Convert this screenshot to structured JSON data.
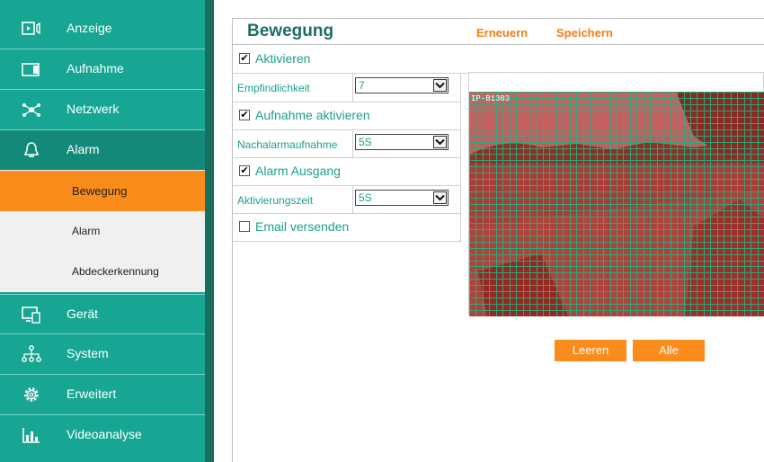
{
  "sidebar": {
    "items": [
      {
        "label": "Anzeige",
        "icon": "display-icon"
      },
      {
        "label": "Aufnahme",
        "icon": "record-icon"
      },
      {
        "label": "Netzwerk",
        "icon": "network-icon"
      },
      {
        "label": "Alarm",
        "icon": "bell-icon"
      },
      {
        "label": "Gerät",
        "icon": "device-icon"
      },
      {
        "label": "System",
        "icon": "hierarchy-icon"
      },
      {
        "label": "Erweitert",
        "icon": "gear-icon"
      },
      {
        "label": "Videoanalyse",
        "icon": "chart-icon"
      }
    ],
    "subitems": [
      {
        "label": "Bewegung",
        "active": true
      },
      {
        "label": "Alarm",
        "active": false
      },
      {
        "label": "Abdeckerkennung",
        "active": false
      }
    ]
  },
  "header": {
    "title": "Bewegung",
    "refresh_label": "Erneuern",
    "save_label": "Speichern"
  },
  "form": {
    "activate": {
      "label": "Aktivieren",
      "checked": true
    },
    "sensitivity": {
      "label": "Empfindlichkeit",
      "value": "7"
    },
    "record_enable": {
      "label": "Aufnahme aktivieren",
      "checked": true
    },
    "post_record": {
      "label": "Nachalarmaufnahme",
      "value": "5S"
    },
    "alarm_output": {
      "label": "Alarm Ausgang",
      "checked": true
    },
    "activation_time": {
      "label": "Aktivierungszeit",
      "value": "5S"
    },
    "email": {
      "label": "Email versenden",
      "checked": false
    }
  },
  "video": {
    "timestamp": "IP-B1303"
  },
  "buttons": {
    "clear_label": "Leeren",
    "all_label": "Alle"
  },
  "colors": {
    "sidebar": "#17a693",
    "sidebar_edge": "#17705f",
    "accent": "#f98c1a",
    "title": "#1d6f63",
    "text": "#1aa08c",
    "grid": "#1eb482",
    "mask": "#c81e1e"
  }
}
